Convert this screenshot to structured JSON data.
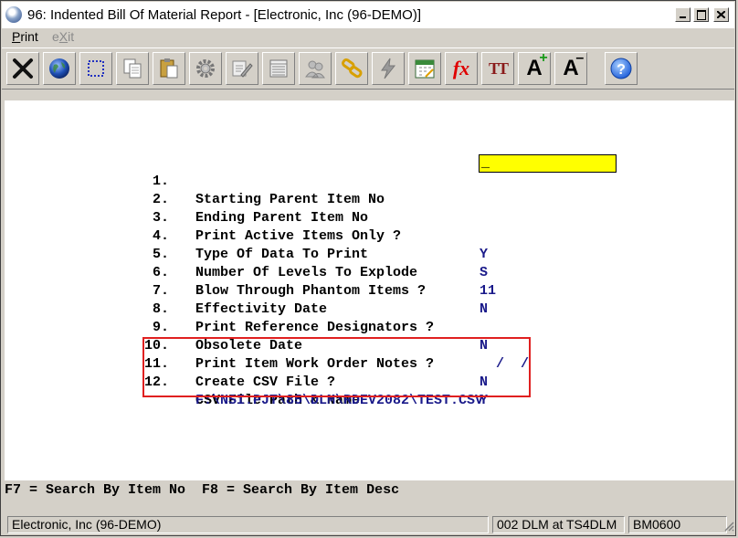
{
  "window": {
    "title": "96: Indented Bill Of Material Report - [Electronic, Inc (96-DEMO)]"
  },
  "menu": {
    "print": {
      "accel": "P",
      "rest": "rint"
    },
    "exit": {
      "pre": "e",
      "accel": "X",
      "rest": "it"
    }
  },
  "toolbar": {
    "buttons": [
      {
        "icon": "close-x-icon"
      },
      {
        "icon": "globe-icon"
      },
      {
        "icon": "select-rectangle-icon"
      },
      {
        "icon": "copy-icon"
      },
      {
        "icon": "paste-icon"
      },
      {
        "icon": "gear-icon"
      },
      {
        "icon": "edit-form-icon"
      },
      {
        "icon": "list-icon"
      },
      {
        "icon": "users-icon"
      },
      {
        "icon": "link-icon"
      },
      {
        "icon": "lightning-icon"
      },
      {
        "icon": "calendar-icon"
      },
      {
        "icon": "function-fx-icon"
      },
      {
        "icon": "text-size-icon"
      },
      {
        "icon": "font-increase-icon"
      },
      {
        "icon": "font-decrease-icon"
      },
      {
        "icon": "help-icon"
      }
    ],
    "fx_text": "fx",
    "tt_text": "TT",
    "a_plus": "A",
    "a_minus": "A",
    "help_text": "?"
  },
  "form": {
    "items": [
      {
        "num": "1.",
        "label": "Starting Parent Item No",
        "value": "_"
      },
      {
        "num": "2.",
        "label": "Ending Parent Item No",
        "value": ""
      },
      {
        "num": "3.",
        "label": "Print Active Items Only ?",
        "value": "Y"
      },
      {
        "num": "4.",
        "label": "Type Of Data To Print",
        "value": "S"
      },
      {
        "num": "5.",
        "label": "Number Of Levels To Explode",
        "value": "11"
      },
      {
        "num": "6.",
        "label": "Blow Through Phantom Items ?",
        "value": "N"
      },
      {
        "num": "7.",
        "label": "Effectivity Date",
        "value": ""
      },
      {
        "num": "8.",
        "label": "Print Reference Designators ?",
        "value": "N"
      },
      {
        "num": "9.",
        "label": "Obsolete Date",
        "value": "  /  /"
      },
      {
        "num": "10.",
        "label": "Print Item Work Order Notes ?",
        "value": "N"
      },
      {
        "num": "11.",
        "label": "Create CSV File ?",
        "value": "Y"
      },
      {
        "num": "12.",
        "label": "CSV File Path & Name",
        "value": ""
      }
    ],
    "csv_path": "F:\\NSI.PJT\\85\\DLM\\RDEV2082\\TEST.CSV"
  },
  "fkeys": "F7 = Search By Item No  F8 = Search By Item Desc",
  "status": {
    "company": "Electronic, Inc (96-DEMO)",
    "user": "002 DLM at TS4DLM",
    "code": "BM0600"
  },
  "colors": {
    "highlight": "#e02020",
    "input_bg": "#ffff00",
    "value_text": "#1a1a8a"
  }
}
